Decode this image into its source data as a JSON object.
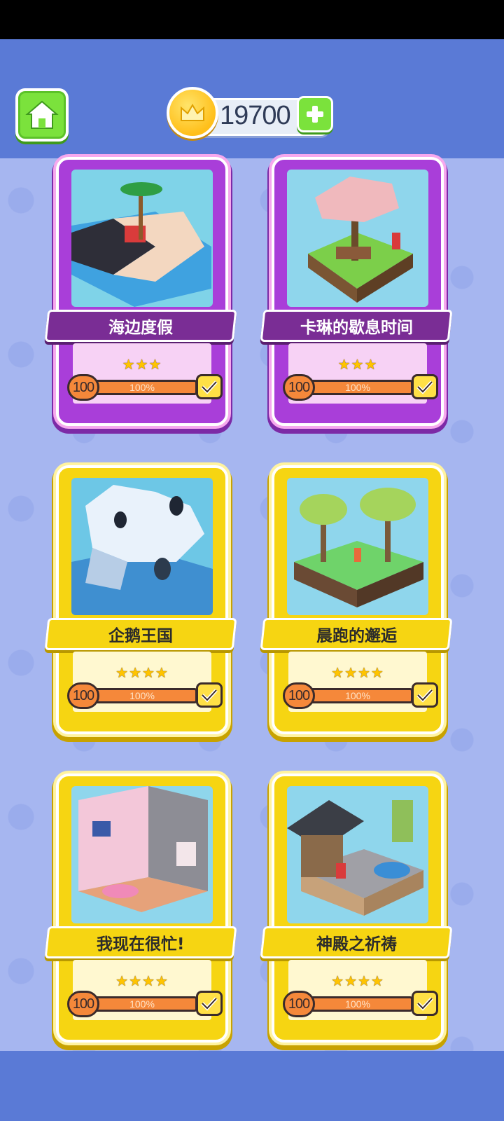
{
  "header": {
    "coins": "19700"
  },
  "icons": {
    "home": "home-icon",
    "coin": "crown-coin-icon",
    "add": "plus-icon",
    "check": "check-icon",
    "star": "star-icon"
  },
  "colors": {
    "header_bg": "#5a7ad6",
    "page_bg": "#a6b6f0",
    "card_purple": "#a93ed9",
    "card_yellow": "#f6d512",
    "progress_fill": "#f5883a",
    "button_green": "#7be23c"
  },
  "levels": [
    {
      "title": "海边度假",
      "stars": "★★★",
      "star_count": 3,
      "count": "100",
      "percent": "100%",
      "progress": 1.0,
      "completed": true,
      "theme": "purple"
    },
    {
      "title": "卡琳的歇息时间",
      "stars": "★★★",
      "star_count": 3,
      "count": "100",
      "percent": "100%",
      "progress": 1.0,
      "completed": true,
      "theme": "purple"
    },
    {
      "title": "企鹅王国",
      "stars": "★★★★",
      "star_count": 4,
      "count": "100",
      "percent": "100%",
      "progress": 1.0,
      "completed": true,
      "theme": "yellow"
    },
    {
      "title": "晨跑的邂逅",
      "stars": "★★★★",
      "star_count": 4,
      "count": "100",
      "percent": "100%",
      "progress": 1.0,
      "completed": true,
      "theme": "yellow"
    },
    {
      "title": "我现在很忙!",
      "stars": "★★★★",
      "star_count": 4,
      "count": "100",
      "percent": "100%",
      "progress": 1.0,
      "completed": true,
      "theme": "yellow"
    },
    {
      "title": "神殿之祈祷",
      "stars": "★★★★",
      "star_count": 4,
      "count": "100",
      "percent": "100%",
      "progress": 1.0,
      "completed": true,
      "theme": "yellow"
    }
  ]
}
